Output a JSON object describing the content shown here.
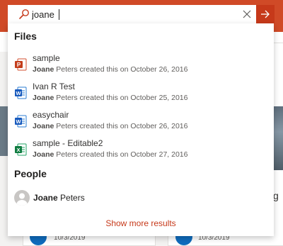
{
  "search": {
    "query": "joane",
    "colors": {
      "accent": "#c6391a",
      "header": "#d04a27"
    },
    "icons": {
      "search": "search-icon",
      "clear": "close-icon",
      "go": "arrow-right-icon"
    }
  },
  "files": {
    "heading": "Files",
    "items": [
      {
        "name": "sample",
        "type": "powerpoint",
        "icon": "powerpoint-file-icon",
        "icon_letter": "P",
        "color": "#c43e1c",
        "author": "Joane",
        "meta_suffix": " Peters created this on October 26, 2016"
      },
      {
        "name": "Ivan R Test",
        "type": "word",
        "icon": "word-file-icon",
        "icon_letter": "W",
        "color": "#185abd",
        "author": "Joane",
        "meta_suffix": " Peters created this on October 25, 2016"
      },
      {
        "name": "easychair",
        "type": "word",
        "icon": "word-file-icon",
        "icon_letter": "W",
        "color": "#185abd",
        "author": "Joane",
        "meta_suffix": " Peters created this on October 26, 2016"
      },
      {
        "name": "sample - Editable2",
        "type": "excel",
        "icon": "excel-file-icon",
        "icon_letter": "X",
        "color": "#107c41",
        "author": "Joane",
        "meta_suffix": " Peters created this on October 27, 2016"
      }
    ]
  },
  "people": {
    "heading": "People",
    "items": [
      {
        "first": "Joane",
        "rest": " Peters",
        "icon": "user-avatar-icon"
      }
    ]
  },
  "show_more": "Show more results",
  "background": {
    "dates": [
      "10/3/2019",
      "10/3/2019"
    ],
    "partial_text": "g"
  }
}
